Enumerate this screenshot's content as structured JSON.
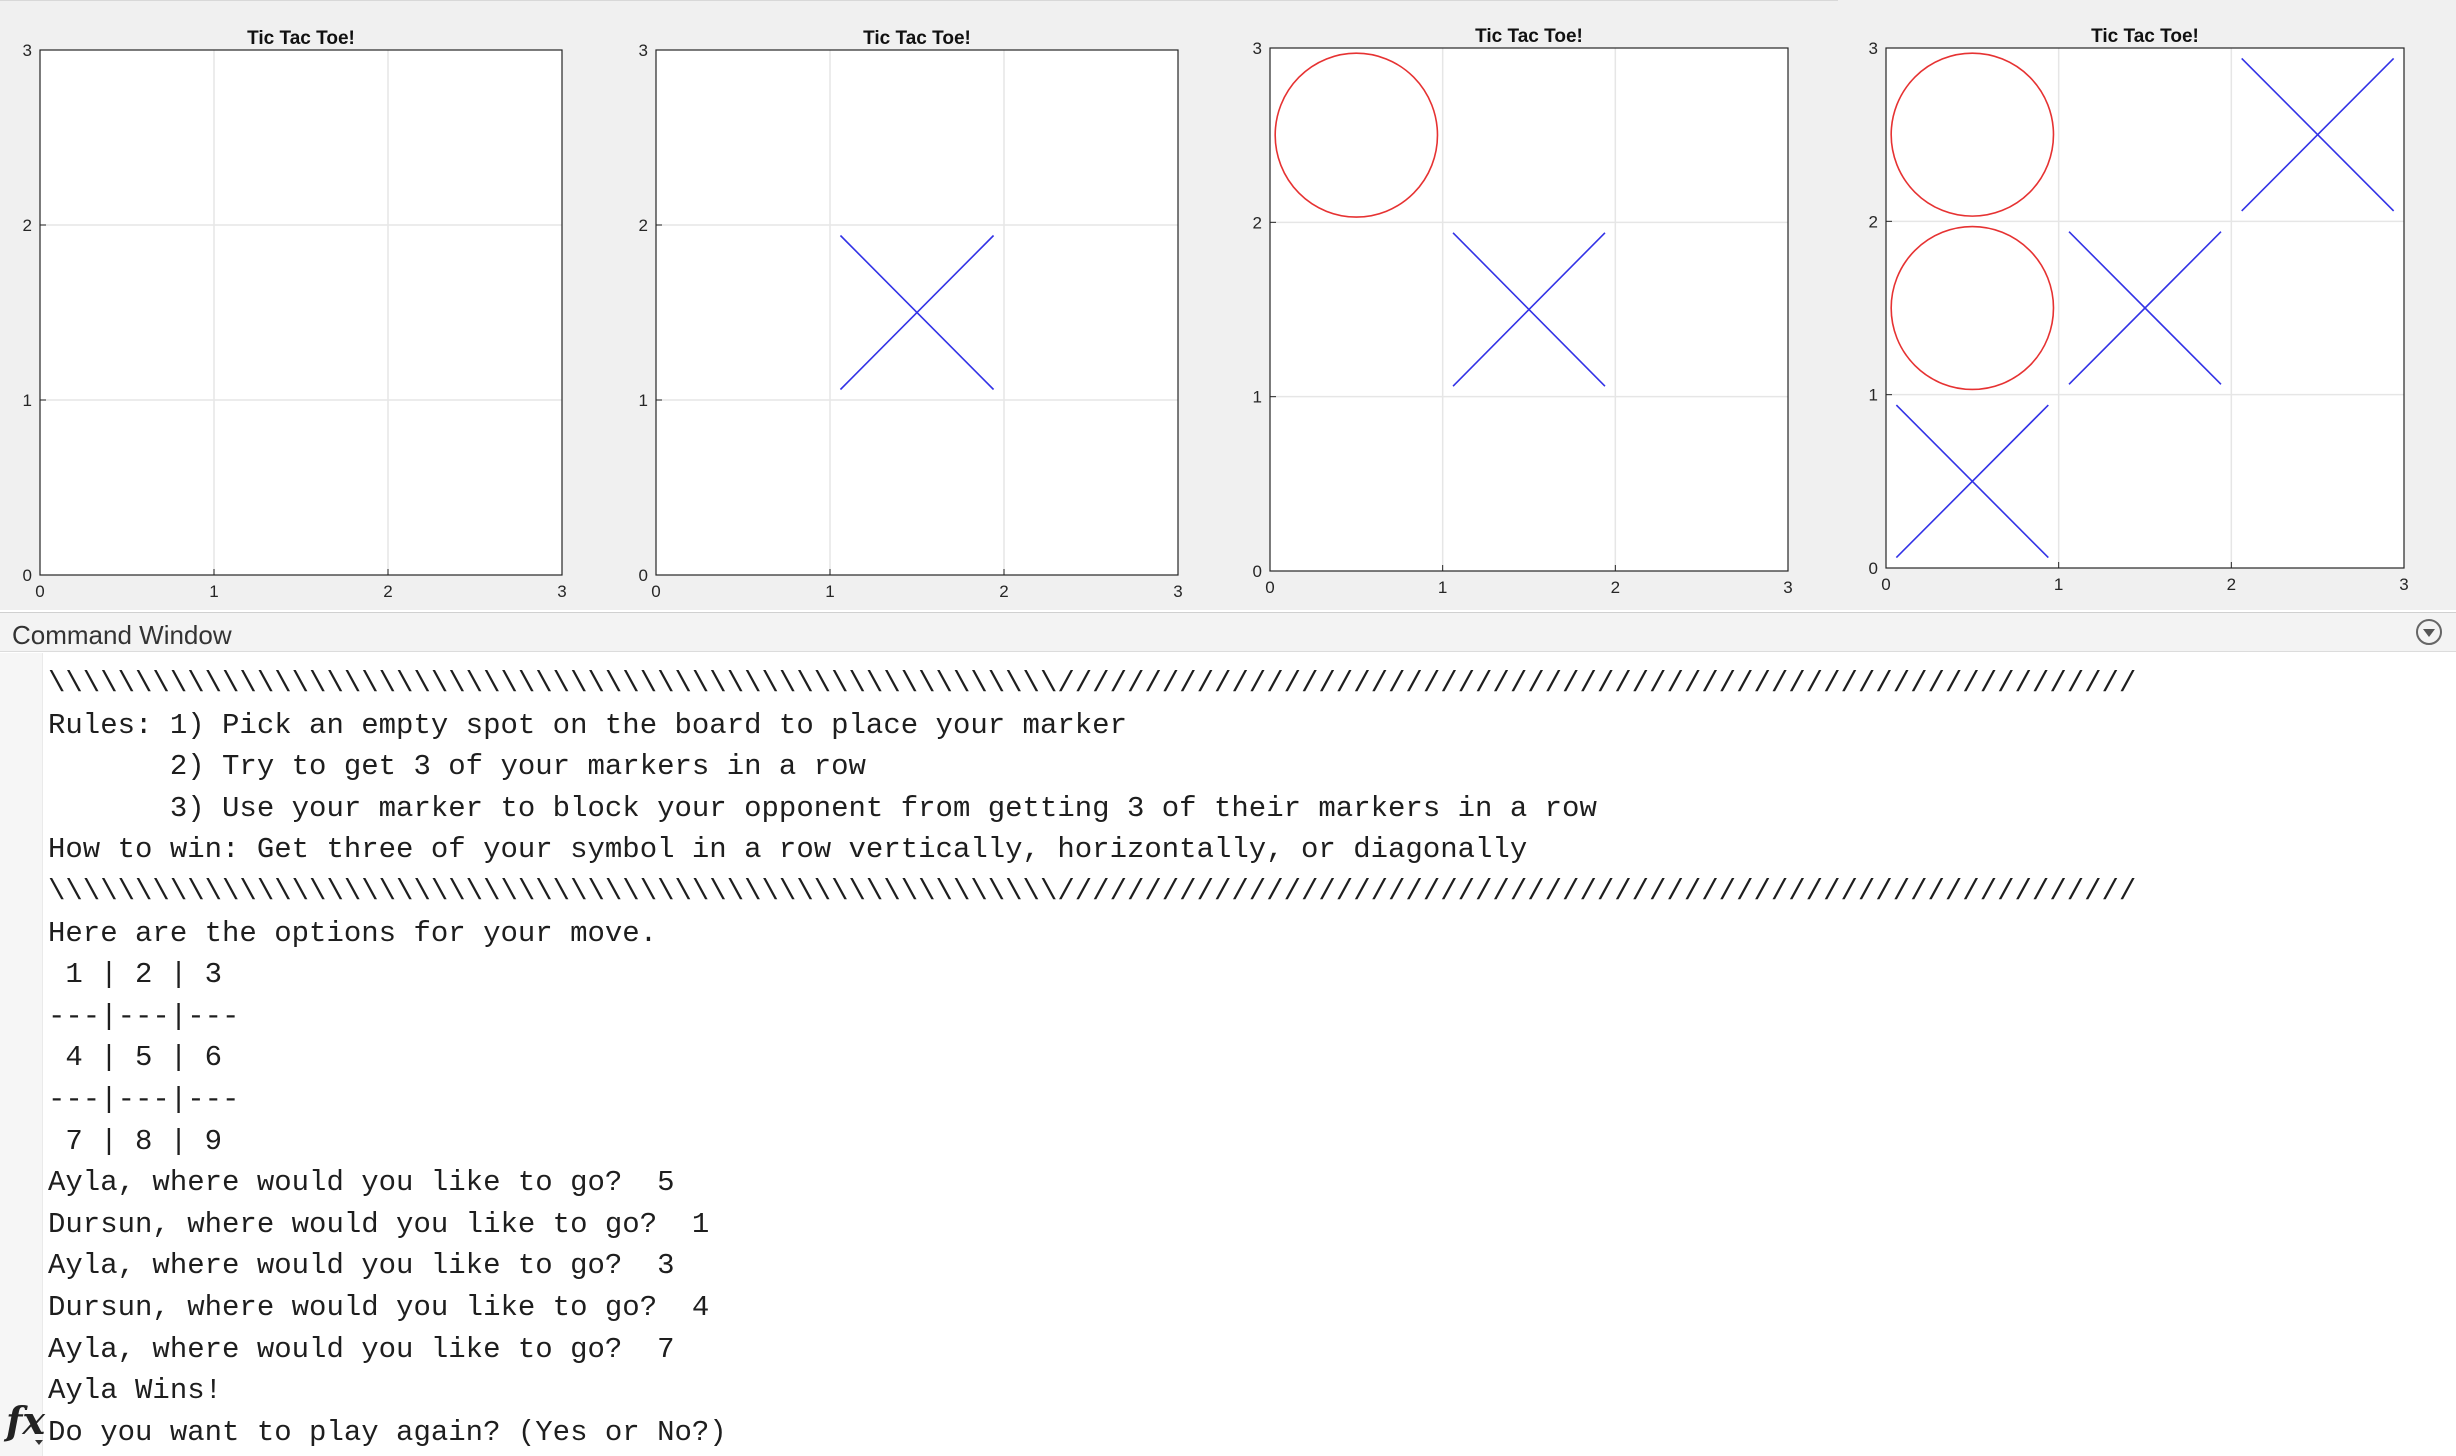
{
  "figures": [
    {
      "title": "Tic Tac Toe!",
      "x_ticks": [
        "0",
        "1",
        "2",
        "3"
      ],
      "y_ticks": [
        "0",
        "1",
        "2",
        "3"
      ],
      "marks": []
    },
    {
      "title": "Tic Tac Toe!",
      "x_ticks": [
        "0",
        "1",
        "2",
        "3"
      ],
      "y_ticks": [
        "0",
        "1",
        "2",
        "3"
      ],
      "marks": [
        {
          "type": "x",
          "cx": 1.5,
          "cy": 1.5
        }
      ]
    },
    {
      "title": "Tic Tac Toe!",
      "x_ticks": [
        "0",
        "1",
        "2",
        "3"
      ],
      "y_ticks": [
        "0",
        "1",
        "2",
        "3"
      ],
      "marks": [
        {
          "type": "x",
          "cx": 1.5,
          "cy": 1.5
        },
        {
          "type": "o",
          "cx": 0.5,
          "cy": 2.5
        }
      ]
    },
    {
      "title": "Tic Tac Toe!",
      "x_ticks": [
        "0",
        "1",
        "2",
        "3"
      ],
      "y_ticks": [
        "0",
        "1",
        "2",
        "3"
      ],
      "marks": [
        {
          "type": "x",
          "cx": 1.5,
          "cy": 1.5
        },
        {
          "type": "o",
          "cx": 0.5,
          "cy": 2.5
        },
        {
          "type": "x",
          "cx": 2.5,
          "cy": 2.5
        },
        {
          "type": "o",
          "cx": 0.5,
          "cy": 1.5
        },
        {
          "type": "x",
          "cx": 0.5,
          "cy": 0.5
        }
      ]
    }
  ],
  "colors": {
    "x_mark": "#3232e6",
    "o_mark": "#e63232",
    "grid": "#e6e6e6",
    "axis": "#262626"
  },
  "command_window": {
    "title": "Command Window",
    "menu_icon": "circle-chevron-down-icon",
    "prompt_icon": "fx-icon",
    "lines": [
      "\\\\\\\\\\\\\\\\\\\\\\\\\\\\\\\\\\\\\\\\\\\\\\\\\\\\\\\\\\\\\\\\\\\\\\\\\\\\\\\\\\\\\\\\\\\\\\\\\\\\\\\\\\\\\\\\\\\\//////////////////////////////////////////////////////////////",
      "Rules: 1) Pick an empty spot on the board to place your marker",
      "       2) Try to get 3 of your markers in a row",
      "       3) Use your marker to block your opponent from getting 3 of their markers in a row",
      "How to win: Get three of your symbol in a row vertically, horizontally, or diagonally",
      "\\\\\\\\\\\\\\\\\\\\\\\\\\\\\\\\\\\\\\\\\\\\\\\\\\\\\\\\\\\\\\\\\\\\\\\\\\\\\\\\\\\\\\\\\\\\\\\\\\\\\\\\\\\\\\\\\\\\//////////////////////////////////////////////////////////////",
      "Here are the options for your move.",
      " 1 | 2 | 3",
      "---|---|---",
      " 4 | 5 | 6",
      "---|---|---",
      " 7 | 8 | 9",
      "Ayla, where would you like to go?  5",
      "Dursun, where would you like to go?  1",
      "Ayla, where would you like to go?  3",
      "Dursun, where would you like to go?  4",
      "Ayla, where would you like to go?  7",
      "Ayla Wins!",
      "Do you want to play again? (Yes or No?)"
    ]
  }
}
